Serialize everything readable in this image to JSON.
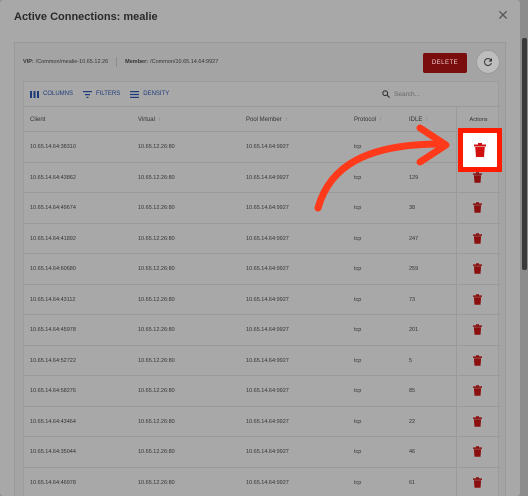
{
  "dialog": {
    "title": "Active Connections: mealie",
    "close_icon": "close-icon"
  },
  "info": {
    "vip_label": "VIP:",
    "vip_value": "/Common/mealie-10.65.12.26",
    "member_label": "Member:",
    "member_value": "/Common/10.65.14.64:9927"
  },
  "actions": {
    "delete_label": "DELETE",
    "refresh_icon": "refresh-icon"
  },
  "toolbar": {
    "columns_label": "COLUMNS",
    "filters_label": "FILTERS",
    "density_label": "DENSITY",
    "search_placeholder": "Search..."
  },
  "columns": {
    "client": "Client",
    "virtual": "Virtual",
    "pool_member": "Pool Member",
    "protocol": "Protocol",
    "idle": "IDLE",
    "actions": "Actions"
  },
  "rows": [
    {
      "client": "10.65.14.64:38310",
      "virtual": "10.65.12.26:80",
      "pool_member": "10.65.14.64:9927",
      "protocol": "tcp",
      "idle": ""
    },
    {
      "client": "10.65.14.64:43862",
      "virtual": "10.65.12.26:80",
      "pool_member": "10.65.14.64:9927",
      "protocol": "tcp",
      "idle": "129"
    },
    {
      "client": "10.65.14.64:49674",
      "virtual": "10.65.12.26:80",
      "pool_member": "10.65.14.64:9927",
      "protocol": "tcp",
      "idle": "38"
    },
    {
      "client": "10.65.14.64:41892",
      "virtual": "10.65.12.26:80",
      "pool_member": "10.65.14.64:9927",
      "protocol": "tcp",
      "idle": "247"
    },
    {
      "client": "10.65.14.64:60680",
      "virtual": "10.65.12.26:80",
      "pool_member": "10.65.14.64:9927",
      "protocol": "tcp",
      "idle": "259"
    },
    {
      "client": "10.65.14.64:43112",
      "virtual": "10.65.12.26:80",
      "pool_member": "10.65.14.64:9927",
      "protocol": "tcp",
      "idle": "73"
    },
    {
      "client": "10.65.14.64:45978",
      "virtual": "10.65.12.26:80",
      "pool_member": "10.65.14.64:9927",
      "protocol": "tcp",
      "idle": "201"
    },
    {
      "client": "10.65.14.64:52722",
      "virtual": "10.65.12.26:80",
      "pool_member": "10.65.14.64:9927",
      "protocol": "tcp",
      "idle": "5"
    },
    {
      "client": "10.65.14.64:58276",
      "virtual": "10.65.12.26:80",
      "pool_member": "10.65.14.64:9927",
      "protocol": "tcp",
      "idle": "85"
    },
    {
      "client": "10.65.14.64:43464",
      "virtual": "10.65.12.26:80",
      "pool_member": "10.65.14.64:9927",
      "protocol": "tcp",
      "idle": "22"
    },
    {
      "client": "10.65.14.64:35044",
      "virtual": "10.65.12.26:80",
      "pool_member": "10.65.14.64:9927",
      "protocol": "tcp",
      "idle": "46"
    },
    {
      "client": "10.65.14.64:46978",
      "virtual": "10.65.12.26:80",
      "pool_member": "10.65.14.64:9927",
      "protocol": "tcp",
      "idle": "61"
    }
  ],
  "colors": {
    "delete": "#7a0d0d",
    "trash": "#8b0f0f",
    "toolbar_text": "#1d3b7a",
    "annotation": "#ff3a1a"
  }
}
